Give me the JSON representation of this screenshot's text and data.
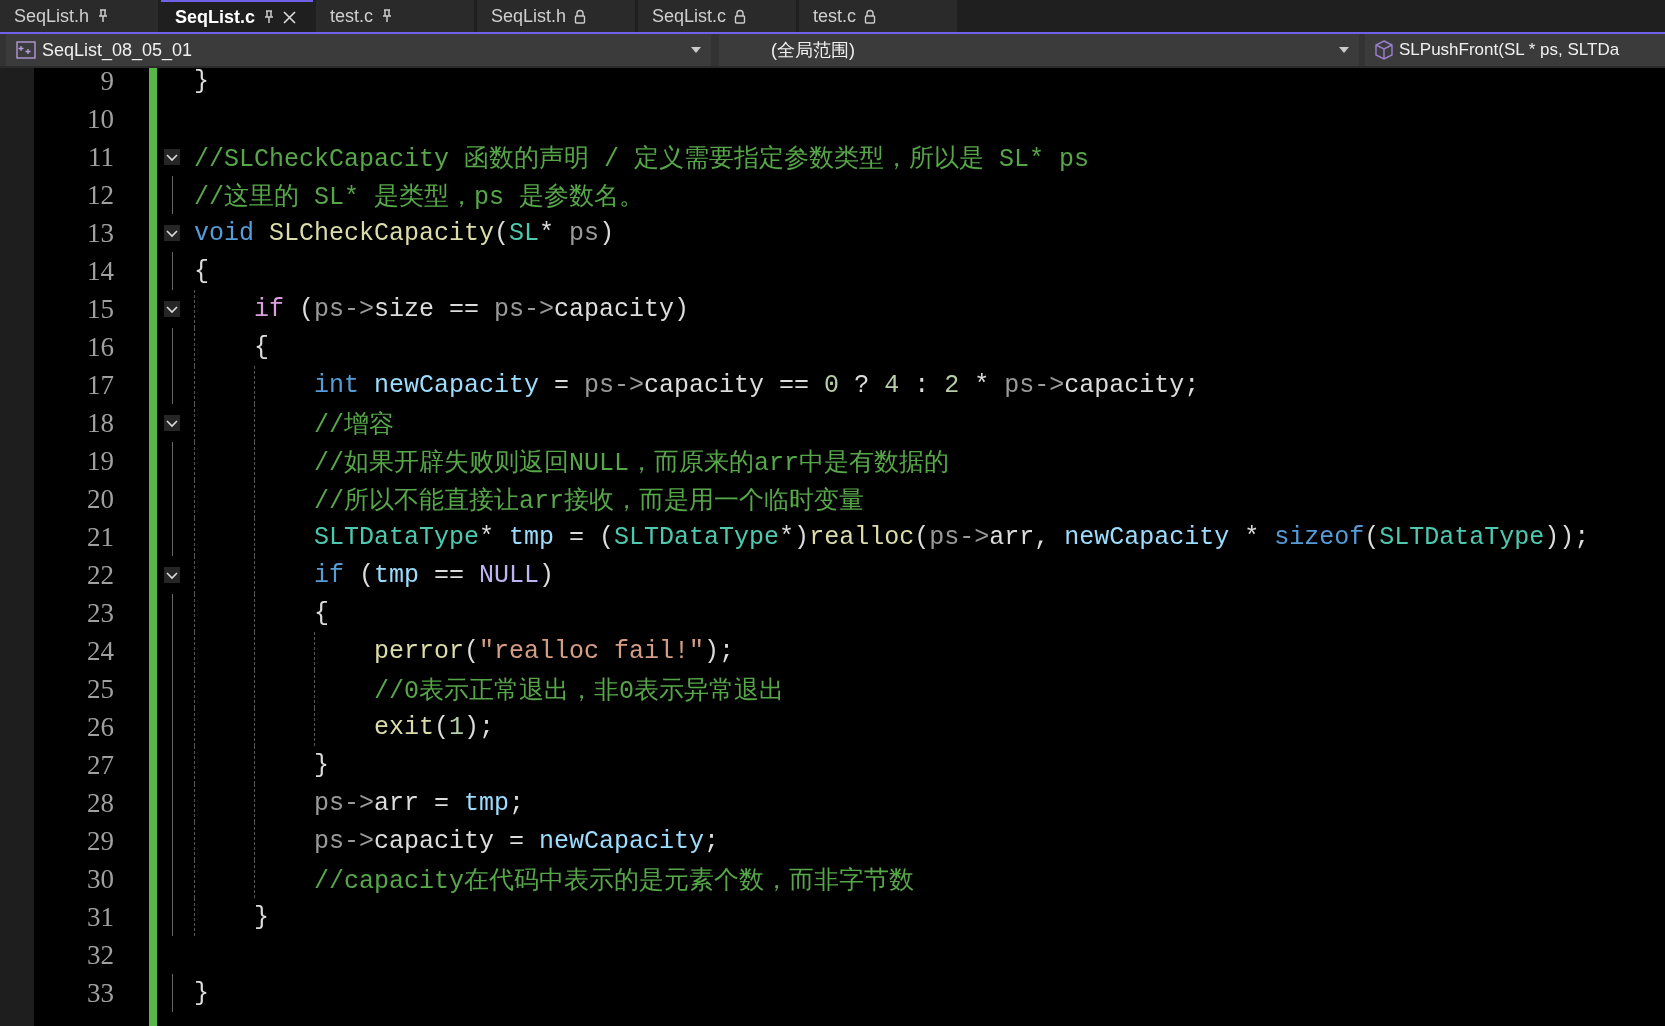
{
  "tabs": [
    {
      "label": "SeqList.h",
      "kind": "pin",
      "selected": false,
      "closable": false
    },
    {
      "label": "SeqList.c",
      "kind": "pin",
      "selected": true,
      "closable": true
    },
    {
      "label": "test.c",
      "kind": "pin",
      "selected": false,
      "closable": false
    },
    {
      "label": "SeqList.h",
      "kind": "lock",
      "selected": false,
      "closable": false
    },
    {
      "label": "SeqList.c",
      "kind": "lock",
      "selected": false,
      "closable": false
    },
    {
      "label": "test.c",
      "kind": "lock",
      "selected": false,
      "closable": false
    }
  ],
  "navigation_bar": {
    "project": "SeqList_08_05_01",
    "scope": "(全局范围)",
    "member": "SLPushFront(SL * ps, SLTDa"
  },
  "editor": {
    "lines": [
      {
        "number": "9",
        "fold": false,
        "tokens": [
          {
            "kind": "plain",
            "text": "}"
          }
        ]
      },
      {
        "number": "10",
        "fold": false
      },
      {
        "number": "11",
        "fold": true,
        "tokens": [
          {
            "kind": "comment",
            "text": "//SLCheckCapacity 函数的声明 / 定义需要指定参数类型，所以是 SL* ps"
          }
        ]
      },
      {
        "number": "12",
        "fold": false,
        "tokens": [
          {
            "kind": "comment",
            "text": "//这里的 SL* 是类型，ps 是参数名。"
          }
        ]
      },
      {
        "number": "13",
        "fold": true,
        "tokens": [
          {
            "kind": "keyword",
            "text": "void "
          },
          {
            "kind": "function",
            "text": "SLCheckCapacity"
          },
          {
            "kind": "plain",
            "text": "("
          },
          {
            "kind": "type",
            "text": "SL"
          },
          {
            "kind": "plain",
            "text": "* "
          },
          {
            "kind": "param",
            "text": "ps"
          },
          {
            "kind": "plain",
            "text": ")"
          }
        ]
      },
      {
        "number": "14",
        "fold": false,
        "tokens": [
          {
            "kind": "plain",
            "text": "{"
          }
        ]
      },
      {
        "number": "15",
        "fold": true,
        "tokens": [
          {
            "kind": "control",
            "text": "    if"
          },
          {
            "kind": "plain",
            "text": " ("
          },
          {
            "kind": "param",
            "text": "ps->"
          },
          {
            "kind": "plain",
            "text": "size == "
          },
          {
            "kind": "param",
            "text": "ps->"
          },
          {
            "kind": "plain",
            "text": "capacity)"
          }
        ]
      },
      {
        "number": "16",
        "fold": false,
        "tokens": [
          {
            "kind": "plain",
            "text": "    {"
          }
        ]
      },
      {
        "number": "17",
        "fold": false,
        "tokens": [
          {
            "kind": "keyword",
            "text": "        int "
          },
          {
            "kind": "local",
            "text": "newCapacity"
          },
          {
            "kind": "plain",
            "text": " = "
          },
          {
            "kind": "param",
            "text": "ps->"
          },
          {
            "kind": "plain",
            "text": "capacity == "
          },
          {
            "kind": "number",
            "text": "0"
          },
          {
            "kind": "plain",
            "text": " ? "
          },
          {
            "kind": "number",
            "text": "4"
          },
          {
            "kind": "plain",
            "text": " : "
          },
          {
            "kind": "number",
            "text": "2"
          },
          {
            "kind": "plain",
            "text": " * "
          },
          {
            "kind": "param",
            "text": "ps->"
          },
          {
            "kind": "plain",
            "text": "capacity;"
          }
        ]
      },
      {
        "number": "18",
        "fold": true,
        "tokens": [
          {
            "kind": "comment",
            "text": "        //增容"
          }
        ]
      },
      {
        "number": "19",
        "fold": false,
        "tokens": [
          {
            "kind": "comment",
            "text": "        //如果开辟失败则返回NULL，而原来的arr中是有数据的"
          }
        ]
      },
      {
        "number": "20",
        "fold": false,
        "tokens": [
          {
            "kind": "comment",
            "text": "        //所以不能直接让arr接收，而是用一个临时变量"
          }
        ]
      },
      {
        "number": "21",
        "fold": false,
        "tokens": [
          {
            "kind": "type",
            "text": "        SLTDataType"
          },
          {
            "kind": "plain",
            "text": "* "
          },
          {
            "kind": "local",
            "text": "tmp"
          },
          {
            "kind": "plain",
            "text": " = ("
          },
          {
            "kind": "type",
            "text": "SLTDataType"
          },
          {
            "kind": "plain",
            "text": "*)"
          },
          {
            "kind": "function",
            "text": "realloc"
          },
          {
            "kind": "plain",
            "text": "("
          },
          {
            "kind": "param",
            "text": "ps->"
          },
          {
            "kind": "plain",
            "text": "arr, "
          },
          {
            "kind": "local",
            "text": "newCapacity"
          },
          {
            "kind": "plain",
            "text": " * "
          },
          {
            "kind": "keyword",
            "text": "sizeof"
          },
          {
            "kind": "plain",
            "text": "("
          },
          {
            "kind": "type",
            "text": "SLTDataType"
          },
          {
            "kind": "plain",
            "text": "));"
          }
        ]
      },
      {
        "number": "22",
        "fold": true,
        "tokens": [
          {
            "kind": "keyword",
            "text": "        if"
          },
          {
            "kind": "plain",
            "text": " ("
          },
          {
            "kind": "local",
            "text": "tmp"
          },
          {
            "kind": "plain",
            "text": " == "
          },
          {
            "kind": "macro",
            "text": "NULL"
          },
          {
            "kind": "plain",
            "text": ")"
          }
        ]
      },
      {
        "number": "23",
        "fold": false,
        "tokens": [
          {
            "kind": "plain",
            "text": "        {"
          }
        ]
      },
      {
        "number": "24",
        "fold": false,
        "tokens": [
          {
            "kind": "function",
            "text": "            perror"
          },
          {
            "kind": "plain",
            "text": "("
          },
          {
            "kind": "string",
            "text": "\"realloc fail!\""
          },
          {
            "kind": "plain",
            "text": ");"
          }
        ]
      },
      {
        "number": "25",
        "fold": false,
        "tokens": [
          {
            "kind": "comment",
            "text": "            //0表示正常退出，非0表示异常退出"
          }
        ]
      },
      {
        "number": "26",
        "fold": false,
        "tokens": [
          {
            "kind": "function",
            "text": "            exit"
          },
          {
            "kind": "plain",
            "text": "("
          },
          {
            "kind": "number",
            "text": "1"
          },
          {
            "kind": "plain",
            "text": ");"
          }
        ]
      },
      {
        "number": "27",
        "fold": false,
        "tokens": [
          {
            "kind": "plain",
            "text": "        }"
          }
        ]
      },
      {
        "number": "28",
        "fold": false,
        "tokens": [
          {
            "kind": "param",
            "text": "        ps->"
          },
          {
            "kind": "plain",
            "text": "arr = "
          },
          {
            "kind": "local",
            "text": "tmp"
          },
          {
            "kind": "plain",
            "text": ";"
          }
        ]
      },
      {
        "number": "29",
        "fold": false,
        "tokens": [
          {
            "kind": "param",
            "text": "        ps->"
          },
          {
            "kind": "plain",
            "text": "capacity = "
          },
          {
            "kind": "local",
            "text": "newCapacity"
          },
          {
            "kind": "plain",
            "text": ";"
          }
        ]
      },
      {
        "number": "30",
        "fold": false,
        "tokens": [
          {
            "kind": "comment",
            "text": "        //capacity在代码中表示的是元素个数，而非字节数"
          }
        ]
      },
      {
        "number": "31",
        "fold": false,
        "tokens": [
          {
            "kind": "plain",
            "text": "    }"
          }
        ]
      },
      {
        "number": "32",
        "fold": false
      },
      {
        "number": "33",
        "fold": false,
        "tokens": [
          {
            "kind": "plain",
            "text": "}"
          }
        ]
      }
    ]
  }
}
